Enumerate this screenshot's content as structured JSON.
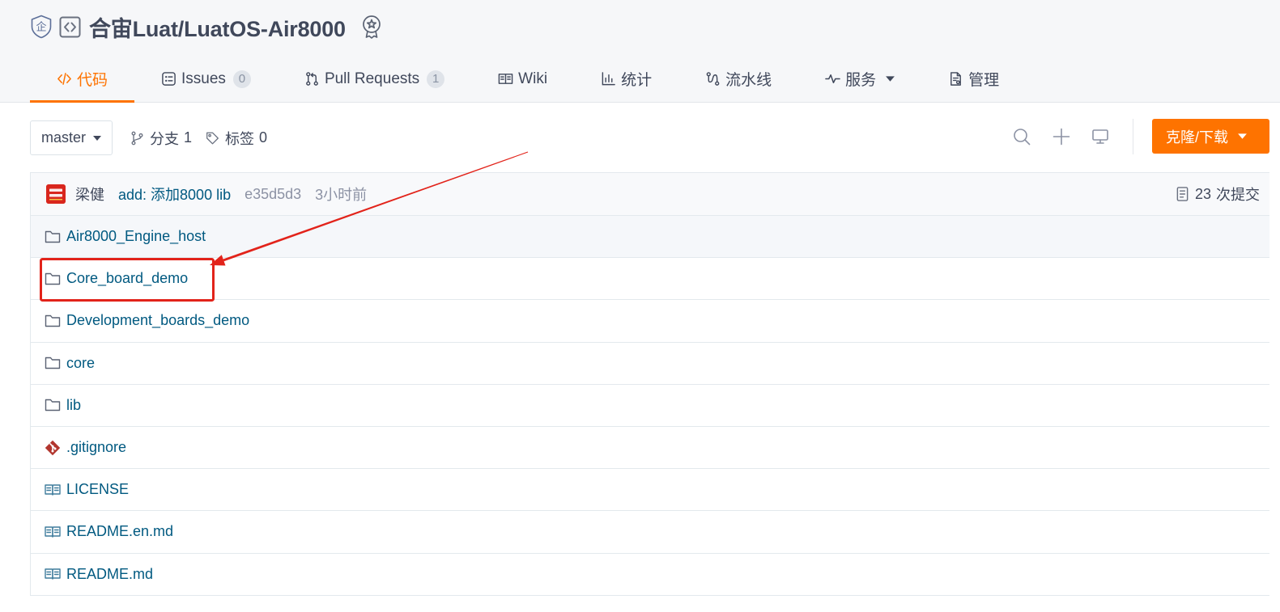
{
  "header": {
    "enterprise_badge": "企",
    "title": "合宙Luat/LuatOS-Air8000"
  },
  "tabs": [
    {
      "label": "代码",
      "icon": "code-icon",
      "active": true
    },
    {
      "label": "Issues",
      "count": "0",
      "icon": "issues-icon"
    },
    {
      "label": "Pull Requests",
      "count": "1",
      "icon": "pull-request-icon"
    },
    {
      "label": "Wiki",
      "icon": "wiki-icon"
    },
    {
      "label": "统计",
      "icon": "stats-icon"
    },
    {
      "label": "流水线",
      "icon": "pipeline-icon"
    },
    {
      "label": "服务",
      "icon": "service-icon"
    },
    {
      "label": "管理",
      "icon": "manage-icon"
    }
  ],
  "toolbar": {
    "branch_select": "master",
    "branches_label": "分支",
    "branches_count": "1",
    "tags_label": "标签",
    "tags_count": "0",
    "clone_button": "克隆/下载"
  },
  "commit": {
    "author": "梁健",
    "message": "add: 添加8000 lib",
    "hash": "e35d5d3",
    "time": "3小时前",
    "commits_count": "23",
    "commits_label": "次提交"
  },
  "files": [
    {
      "name": "Air8000_Engine_host",
      "icon": "folder-icon"
    },
    {
      "name": "Core_board_demo",
      "icon": "folder-icon"
    },
    {
      "name": "Development_boards_demo",
      "icon": "folder-icon"
    },
    {
      "name": "core",
      "icon": "folder-icon"
    },
    {
      "name": "lib",
      "icon": "folder-icon"
    },
    {
      "name": ".gitignore",
      "icon": "git-file-icon"
    },
    {
      "name": "LICENSE",
      "icon": "book-icon"
    },
    {
      "name": "README.en.md",
      "icon": "book-icon"
    },
    {
      "name": "README.md",
      "icon": "book-icon"
    }
  ],
  "colors": {
    "accent": "#fe7300",
    "link": "#005980",
    "text": "#40485b",
    "muted": "#8c92a4",
    "annotation": "#e2231a"
  }
}
